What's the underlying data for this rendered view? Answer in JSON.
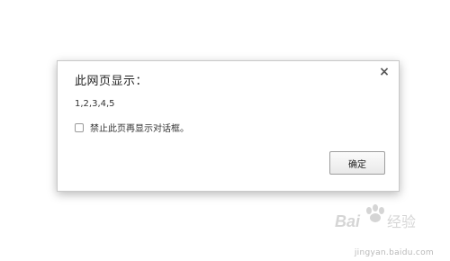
{
  "dialog": {
    "title": "此网页显示：",
    "message": "1,2,3,4,5",
    "suppress_checkbox_label": "禁止此页再显示对话框。",
    "suppress_checked": false,
    "ok_label": "确定",
    "close_glyph": "×"
  },
  "watermark": {
    "text": "Baidu 经验",
    "subtext": "jingyan.baidu.com"
  },
  "colors": {
    "background": "#ffffff",
    "dialog_border": "#c9c9c9",
    "button_border": "#9e9e9e"
  }
}
